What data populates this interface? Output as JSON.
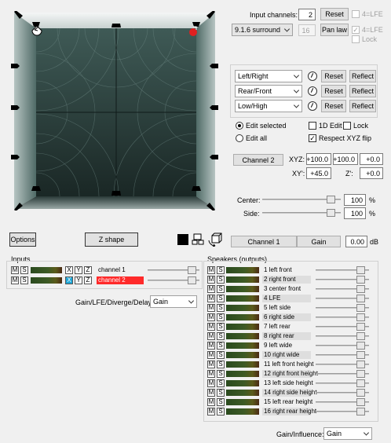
{
  "panner": {
    "corner_markers": 8,
    "edge_markers": 8
  },
  "top": {
    "input_channels_label": "Input channels:",
    "input_channels_value": "2",
    "reset_label": "Reset",
    "lfe_label": "4=LFE",
    "layout_value": "9.1.6 surround",
    "count_value": "16",
    "pan_law_label": "Pan law",
    "lfe2_label": "4=LFE",
    "lock_label": "Lock"
  },
  "axes": [
    {
      "label": "Left/Right",
      "reset": "Reset",
      "reflect": "Reflect"
    },
    {
      "label": "Rear/Front",
      "reset": "Reset",
      "reflect": "Reflect"
    },
    {
      "label": "Low/High",
      "reset": "Reset",
      "reflect": "Reflect"
    }
  ],
  "edit": {
    "edit_selected": "Edit selected",
    "edit_all": "Edit all",
    "one_d_edit": "1D Edit",
    "lock": "Lock",
    "respect_flip": "Respect XYZ flip",
    "respect_flip_checked": "✓"
  },
  "coords": {
    "channel_button": "Channel 2",
    "xyz_label": "XYZ:",
    "x": "+100.0",
    "y": "+100.0",
    "z": "+0.0",
    "xyp_label": "XY':",
    "xyp": "+45.0",
    "zp_label": "Z':",
    "zp": "+0.0"
  },
  "center": {
    "label": "Center:",
    "value": "100",
    "unit": "%",
    "level": 0.92
  },
  "side": {
    "label": "Side:",
    "value": "100",
    "unit": "%",
    "level": 0.92
  },
  "toolbar": {
    "options": "Options",
    "zshape": "Z shape",
    "channel_button": "Channel 1",
    "gain_button": "Gain",
    "gain_value": "0.00",
    "gain_unit": "dB"
  },
  "inputs": {
    "title": "Inputs",
    "rows": [
      {
        "name": "channel 1",
        "selected": false,
        "level": 0.92
      },
      {
        "name": "channel 2",
        "selected": true,
        "level": 0.92
      }
    ]
  },
  "gain_mode": {
    "label": "Gain/LFE/Diverge/Delay:",
    "value": "Gain"
  },
  "speakers": {
    "title": "Speakers (outputs)",
    "rows": [
      {
        "name": "1 left front",
        "level": 0.92
      },
      {
        "name": "2 right front",
        "level": 0.92
      },
      {
        "name": "3 center front",
        "level": 0.92
      },
      {
        "name": "4 LFE",
        "level": 0.92
      },
      {
        "name": "5 left side",
        "level": 0.92
      },
      {
        "name": "6 right side",
        "level": 0.92
      },
      {
        "name": "7 left rear",
        "level": 0.92
      },
      {
        "name": "8 right rear",
        "level": 0.92
      },
      {
        "name": "9 left wide",
        "level": 0.92
      },
      {
        "name": "10 right wide",
        "level": 0.92
      },
      {
        "name": "11 left front height",
        "level": 0.92
      },
      {
        "name": "12 right front height",
        "level": 0.92
      },
      {
        "name": "13 left side height",
        "level": 0.92
      },
      {
        "name": "14 right side height",
        "level": 0.92
      },
      {
        "name": "15 left rear height",
        "level": 0.92
      },
      {
        "name": "16 right rear height",
        "level": 0.92
      }
    ]
  },
  "influence": {
    "label": "Gain/Influence:",
    "value": "Gain"
  },
  "labels": {
    "m": "M",
    "s": "S",
    "x": "X",
    "y": "Y",
    "z": "Z"
  },
  "colors": {
    "selected_row": "#ff2a2a",
    "channel_marker": "#e02020",
    "xyz_active": "#1ea7d8",
    "field_dark": "#1e2e2c"
  }
}
